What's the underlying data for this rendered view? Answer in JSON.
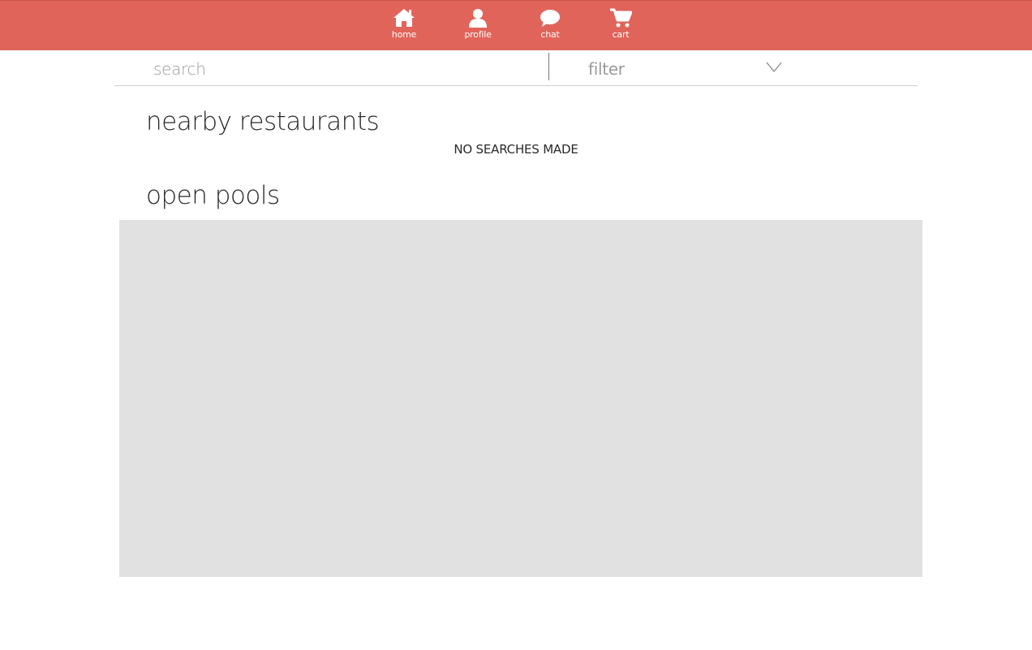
{
  "nav": {
    "items": [
      {
        "label": "home",
        "icon": "home-icon"
      },
      {
        "label": "profile",
        "icon": "user-icon"
      },
      {
        "label": "chat",
        "icon": "chat-bubble-icon"
      },
      {
        "label": "cart",
        "icon": "cart-icon"
      }
    ]
  },
  "search": {
    "placeholder": "search",
    "value": ""
  },
  "filter": {
    "label": "filter",
    "icon": "chevron-down-icon"
  },
  "restaurants": {
    "title": "nearby restaurants",
    "empty_message": "NO SEARCHES MADE"
  },
  "pools": {
    "title": "open pools"
  },
  "colors": {
    "accent": "#e0645a",
    "panel": "#e1e1e1",
    "text": "#2a2a2a",
    "muted": "#9a9a9a"
  }
}
